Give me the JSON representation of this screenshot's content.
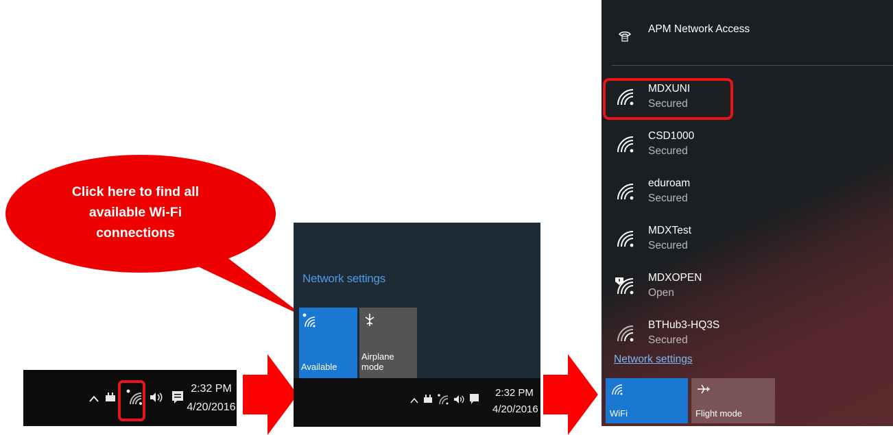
{
  "callout": {
    "text": "Click here to find all available Wi-Fi connections",
    "color": "#ee0000"
  },
  "taskbar": {
    "time": "2:32 PM",
    "date": "4/20/2016",
    "icons": [
      "chevron-up-icon",
      "power-plug-icon",
      "wifi-icon",
      "volume-icon",
      "notifications-icon"
    ]
  },
  "quick_panel": {
    "network_settings": "Network settings",
    "tiles": [
      {
        "label": "Available",
        "icon": "wifi-icon",
        "color": "#1a78d2"
      },
      {
        "label": "Airplane mode",
        "icon": "airplane-icon",
        "color": "#545454"
      }
    ],
    "time": "2:32 PM",
    "date": "4/20/2016"
  },
  "network_panel": {
    "vpn": {
      "name": "APM Network Access",
      "icon": "vpn-icon"
    },
    "networks": [
      {
        "name": "MDXUNI",
        "status": "Secured",
        "highlighted": true
      },
      {
        "name": "CSD1000",
        "status": "Secured"
      },
      {
        "name": "eduroam",
        "status": "Secured"
      },
      {
        "name": "MDXTest",
        "status": "Secured"
      },
      {
        "name": "MDXOPEN",
        "status": "Open",
        "open_warning": true
      },
      {
        "name": "BTHub3-HQ3S",
        "status": "Secured"
      }
    ],
    "network_settings": "Network settings",
    "tiles": [
      {
        "label": "WiFi",
        "icon": "wifi-icon",
        "color": "#1a78d2"
      },
      {
        "label": "Flight mode",
        "icon": "airplane-icon",
        "color": "#7a5454"
      }
    ]
  },
  "highlight_color": "#e8141a",
  "arrow_color": "#ff0000"
}
